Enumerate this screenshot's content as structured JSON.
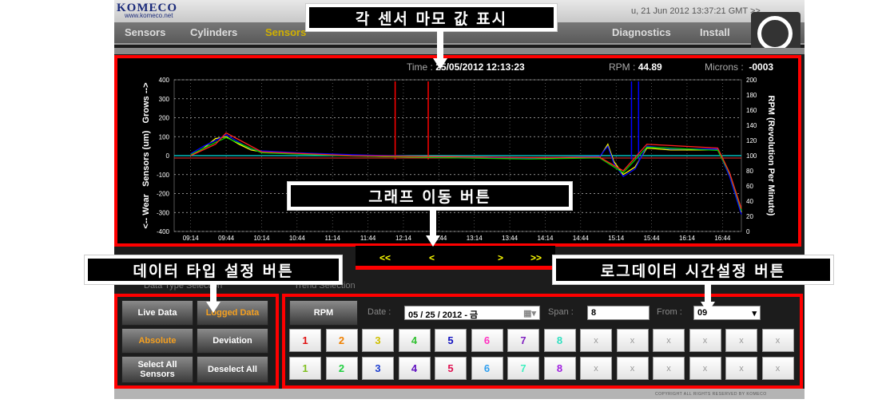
{
  "header": {
    "logo": "KOMECO",
    "logo_sub": "www.komeco.net",
    "clock": "u, 21 Jun 2012 13:37:21 GMT  >>"
  },
  "nav": [
    {
      "label": "Sensors"
    },
    {
      "label": "Cylinders"
    },
    {
      "label": "Sensors",
      "active": true
    },
    {
      "label": "Diagnostics"
    },
    {
      "label": "Install"
    }
  ],
  "readout": {
    "time_label": "Time :",
    "time": "25/05/2012 12:13:23",
    "rpm_label": "RPM :",
    "rpm": "44.89",
    "microns_label": "Microns :",
    "microns": "-0003"
  },
  "chart_data": {
    "type": "line",
    "ylabel": "<-- Wear   Sensors (um)   Grows -->",
    "y2label": "RPM (Revolution Per Minute)",
    "ylim": [
      -400,
      400
    ],
    "y2lim": [
      0,
      200
    ],
    "yticks": [
      400,
      300,
      200,
      100,
      0,
      -100,
      -200,
      -300,
      -400
    ],
    "y2ticks": [
      200,
      180,
      160,
      140,
      120,
      100,
      80,
      60,
      40,
      20,
      0
    ],
    "xlim": [
      "09:00",
      "17:00"
    ],
    "xticks": [
      "09:14",
      "09:44",
      "10:14",
      "10:44",
      "11:14",
      "11:44",
      "12:14",
      "12:44",
      "13:14",
      "13:44",
      "14:14",
      "14:44",
      "15:14",
      "15:44",
      "16:14",
      "16:44"
    ],
    "grid": true,
    "series": [
      {
        "color": "#ffff00",
        "x": [
          "09:14",
          "09:25",
          "09:35",
          "09:44",
          "09:55",
          "10:05",
          "10:14",
          "10:44",
          "11:30",
          "12:00",
          "13:00",
          "14:00",
          "15:00",
          "15:07",
          "15:12",
          "15:20",
          "15:30",
          "15:40",
          "16:00",
          "16:40",
          "16:50",
          "17:00"
        ],
        "y": [
          0,
          40,
          90,
          100,
          60,
          30,
          20,
          10,
          0,
          -5,
          -10,
          -15,
          -10,
          60,
          -30,
          -100,
          -60,
          40,
          30,
          30,
          -100,
          -300
        ]
      },
      {
        "color": "#0000ff",
        "x": [
          "09:14",
          "09:25",
          "09:35",
          "09:44",
          "09:55",
          "10:05",
          "10:14",
          "10:44",
          "11:30",
          "12:00",
          "13:00",
          "14:00",
          "15:00",
          "15:07",
          "15:12",
          "15:20",
          "15:30",
          "15:40",
          "16:00",
          "16:40",
          "16:50",
          "17:00"
        ],
        "y": [
          10,
          50,
          80,
          110,
          70,
          35,
          25,
          15,
          5,
          0,
          -8,
          -12,
          -5,
          50,
          -40,
          -110,
          -70,
          50,
          35,
          35,
          -110,
          -310
        ]
      },
      {
        "color": "#00cc00",
        "x": [
          "09:14",
          "09:35",
          "09:44",
          "10:14",
          "11:30",
          "13:00",
          "14:00",
          "15:00",
          "15:20",
          "15:40",
          "16:40",
          "16:50",
          "17:00"
        ],
        "y": [
          5,
          70,
          95,
          15,
          -2,
          -12,
          -18,
          -12,
          -90,
          45,
          28,
          -95,
          -290
        ]
      },
      {
        "color": "#ff2020",
        "x": [
          "09:14",
          "09:35",
          "09:44",
          "10:14",
          "11:30",
          "13:00",
          "14:00",
          "15:00",
          "15:20",
          "15:40",
          "16:40",
          "16:50",
          "17:00"
        ],
        "y": [
          0,
          60,
          120,
          20,
          0,
          -6,
          -10,
          -8,
          -80,
          60,
          40,
          -90,
          -280
        ]
      }
    ],
    "rpm_series": {
      "color": "#00e0e0",
      "x": [
        "09:00",
        "17:00"
      ],
      "y": [
        100,
        100
      ]
    },
    "spikes": [
      {
        "x": "12:07",
        "color": "#ff0000"
      },
      {
        "x": "12:35",
        "color": "#ff0000"
      },
      {
        "x": "15:27",
        "color": "#0000ff"
      },
      {
        "x": "15:33",
        "color": "#0000ff"
      }
    ]
  },
  "graph_nav": {
    "first": "<<",
    "prev": "<",
    "next": ">",
    "last": ">>"
  },
  "data_type": {
    "section": "Data Type Selection",
    "live": "Live Data",
    "logged": "Logged Data",
    "absolute": "Absolute",
    "deviation": "Deviation",
    "select_all": "Select All Sensors",
    "deselect_all": "Deselect All"
  },
  "trend": {
    "section": "Trend Selection",
    "rpm": "RPM",
    "date_label": "Date :",
    "date": "05 / 25 / 2012 - 금",
    "span_label": "Span :",
    "span": "8",
    "from_label": "From :",
    "from": "09",
    "row1": [
      {
        "t": "1",
        "c": "#e01010"
      },
      {
        "t": "2",
        "c": "#f08000"
      },
      {
        "t": "3",
        "c": "#d0c000"
      },
      {
        "t": "4",
        "c": "#30c030"
      },
      {
        "t": "5",
        "c": "#1010c0"
      },
      {
        "t": "6",
        "c": "#ff30c0"
      },
      {
        "t": "7",
        "c": "#8020c0"
      },
      {
        "t": "8",
        "c": "#30e0c0"
      },
      {
        "t": "x"
      },
      {
        "t": "x"
      },
      {
        "t": "x"
      },
      {
        "t": "x"
      },
      {
        "t": "x"
      },
      {
        "t": "x"
      }
    ],
    "row2": [
      {
        "t": "1",
        "c": "#80c020"
      },
      {
        "t": "2",
        "c": "#20d040"
      },
      {
        "t": "3",
        "c": "#2040d0"
      },
      {
        "t": "4",
        "c": "#6010c0"
      },
      {
        "t": "5",
        "c": "#e01050"
      },
      {
        "t": "6",
        "c": "#30a0f0"
      },
      {
        "t": "7",
        "c": "#40f0c0"
      },
      {
        "t": "8",
        "c": "#a020e0"
      },
      {
        "t": "x"
      },
      {
        "t": "x"
      },
      {
        "t": "x"
      },
      {
        "t": "x"
      },
      {
        "t": "x"
      },
      {
        "t": "x"
      }
    ]
  },
  "footer": {
    "copyright": "COPYRIGHT ALL RIGHTS RESERVED BY KOMECO"
  },
  "callouts": {
    "sensor_values": "각 센서 마모 값 표시",
    "graph_nav": "그래프 이동 버튼",
    "data_type": "데이터 타입 설정 버튼",
    "log_time": "로그데이터 시간설정 버튼"
  }
}
